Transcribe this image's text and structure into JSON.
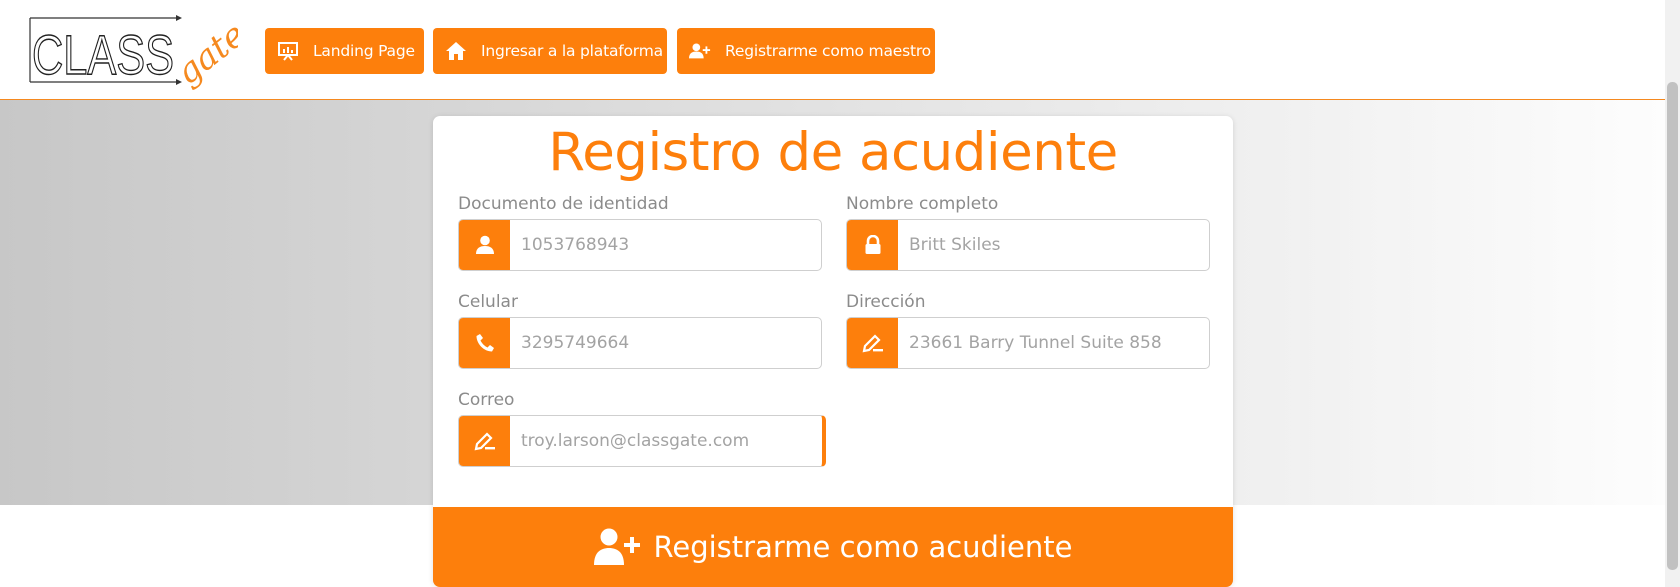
{
  "header": {
    "logo": {
      "text_main": "CLASS",
      "text_script": "gate"
    },
    "nav": [
      {
        "label": "Landing Page",
        "icon": "presentation-icon"
      },
      {
        "label": "Ingresar a la plataforma",
        "icon": "home-icon"
      },
      {
        "label": "Registrarme como maestro",
        "icon": "user-plus-icon"
      }
    ]
  },
  "form": {
    "title": "Registro de acudiente",
    "fields": [
      {
        "label": "Documento de identidad",
        "value": "1053768943",
        "icon": "user-icon"
      },
      {
        "label": "Nombre completo",
        "value": "Britt Skiles",
        "icon": "lock-icon"
      },
      {
        "label": "Celular",
        "value": "3295749664",
        "icon": "phone-icon"
      },
      {
        "label": "Dirección",
        "value": "23661 Barry Tunnel Suite 858",
        "icon": "pen-icon"
      },
      {
        "label": "Correo",
        "value": "troy.larson@classgate.com",
        "icon": "pen-icon"
      }
    ],
    "submit_label": "Registrarme como acudiente",
    "submit_icon": "user-plus-icon"
  },
  "colors": {
    "accent": "#fd7f0c",
    "label": "#8b8b8b",
    "input_text": "#a3a3a3"
  }
}
